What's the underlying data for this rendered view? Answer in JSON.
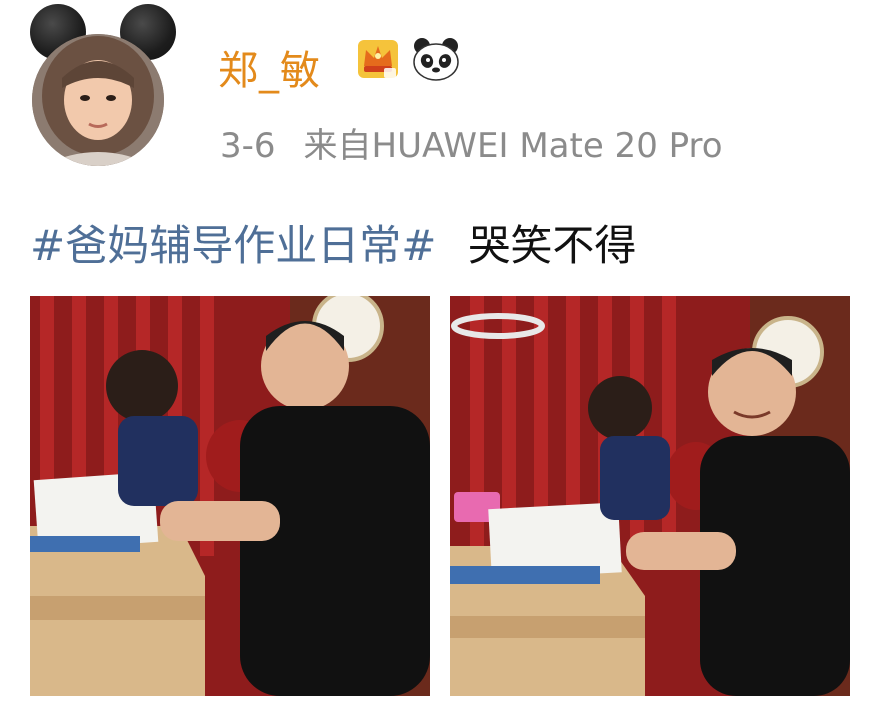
{
  "user": {
    "name": "郑_敏",
    "badges": [
      "crown-badge",
      "panda-badge"
    ]
  },
  "post": {
    "date": "3-6",
    "source": "来自HUAWEI Mate 20 Pro",
    "hashtag": "#爸妈辅导作业日常#",
    "text": "哭笑不得"
  },
  "colors": {
    "username": "#e38a1b",
    "hashtag": "#4f6f97",
    "meta": "#8b8b8b"
  },
  "photos": [
    {
      "name": "photo-homework-1"
    },
    {
      "name": "photo-homework-2"
    }
  ]
}
